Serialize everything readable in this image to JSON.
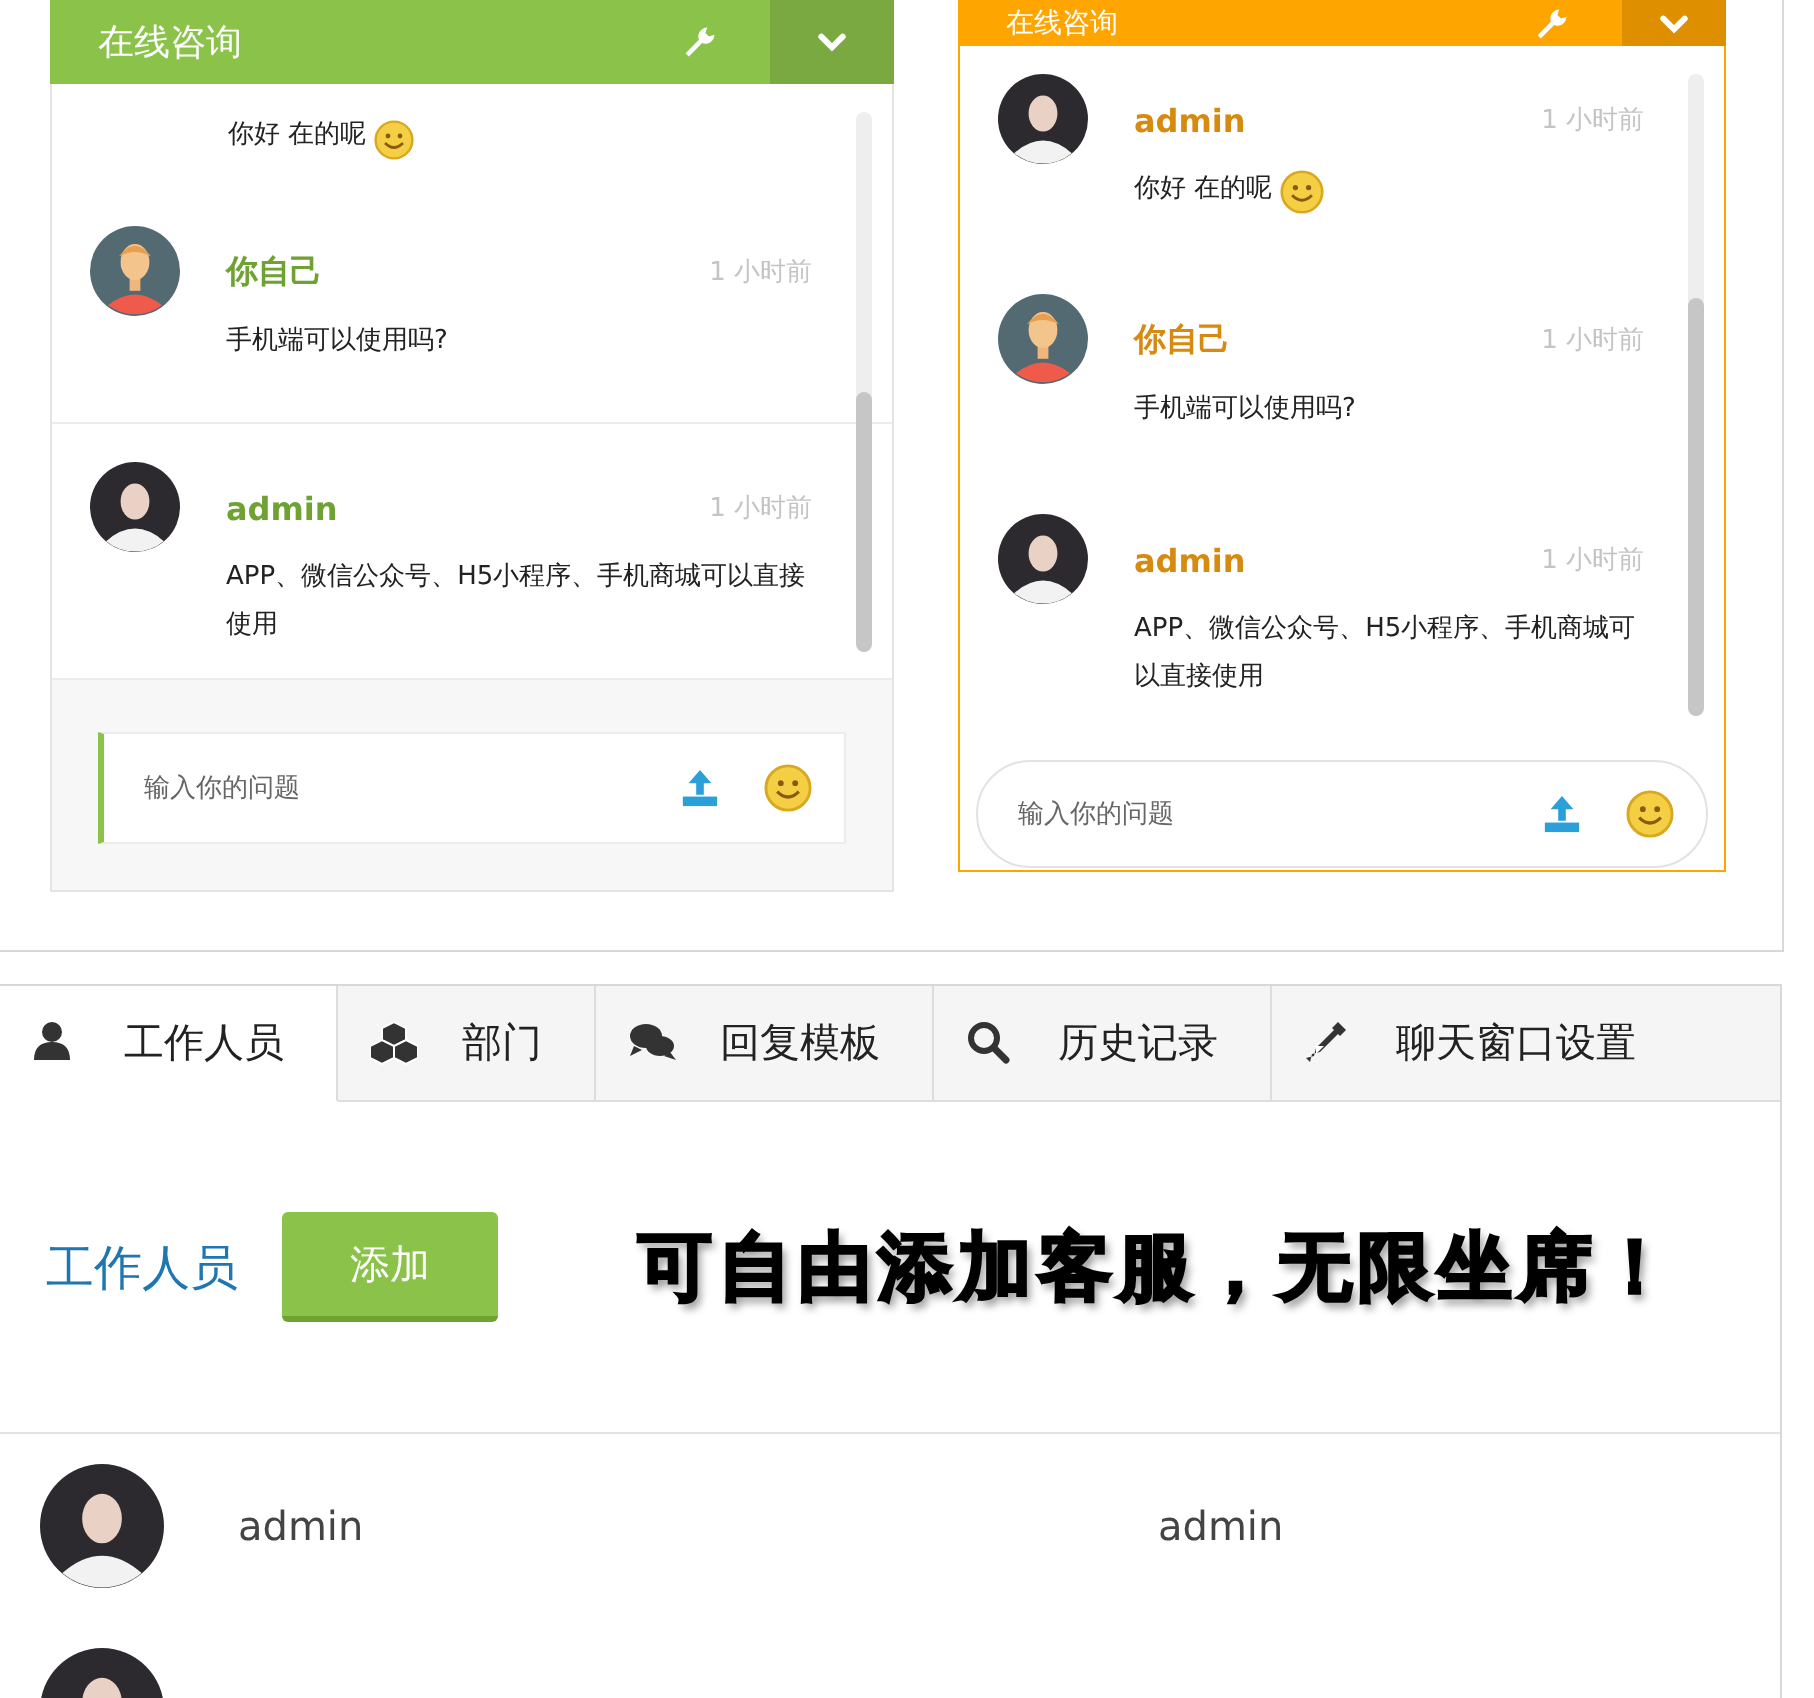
{
  "chat_widgets": [
    {
      "title": "在线咨询",
      "color": "#8bc34a",
      "kind": "boxed",
      "messages": [
        {
          "kind": "partial",
          "text": "你好 在的呢",
          "emoji": true
        },
        {
          "kind": "message",
          "avatar": {
            "kind": "cartoon"
          },
          "sender": "你自己",
          "time": "1 小时前",
          "text": "手机端可以使用吗?",
          "emoji": false
        },
        {
          "kind": "message",
          "avatar": {
            "kind": "photo"
          },
          "sender": "admin",
          "time": "1 小时前",
          "text": "APP、微信公众号、H5小程序、手机商城可以直接使用",
          "emoji": false
        }
      ],
      "input": {
        "placeholder": "输入你的问题"
      }
    },
    {
      "title": "在线咨询",
      "color": "#ffa500",
      "kind": "rounded",
      "messages": [
        {
          "kind": "message",
          "avatar": {
            "kind": "photo"
          },
          "sender": "admin",
          "time": "1 小时前",
          "text": "你好 在的呢",
          "emoji": true
        },
        {
          "kind": "message",
          "avatar": {
            "kind": "cartoon"
          },
          "sender": "你自己",
          "time": "1 小时前",
          "text": "手机端可以使用吗?",
          "emoji": false
        },
        {
          "kind": "message",
          "avatar": {
            "kind": "photo"
          },
          "sender": "admin",
          "time": "1 小时前",
          "text": "APP、微信公众号、H5小程序、手机商城可以直接使用",
          "emoji": false
        }
      ],
      "input": {
        "placeholder": "输入你的问题"
      }
    }
  ],
  "tabs": [
    {
      "label": "工作人员",
      "selected": true
    },
    {
      "label": "部门",
      "selected": false
    },
    {
      "label": "回复模板",
      "selected": false
    },
    {
      "label": "历史记录",
      "selected": false
    },
    {
      "label": "聊天窗口设置",
      "selected": false
    }
  ],
  "staff": {
    "title": "工作人员",
    "add_button": "添加",
    "banner": "可自由添加客服，无限坐席！",
    "rows": [
      {
        "avatar": {
          "kind": "photo"
        },
        "column_1": "admin",
        "column_2": "admin"
      },
      {
        "avatar": {
          "kind": "photo"
        }
      }
    ]
  }
}
